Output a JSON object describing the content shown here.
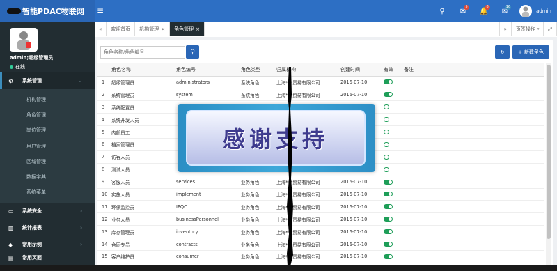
{
  "brand": {
    "title": "智能PDAC物联网"
  },
  "topbar": {
    "badges": [
      "5",
      "8",
      "16"
    ],
    "username": "admin",
    "badge_colors": [
      "#dd4b39",
      "#dd4b39",
      "#3c8dbc"
    ]
  },
  "profile": {
    "name": "admin;超级管理员",
    "status": "在线"
  },
  "menu": {
    "system": "系统管理",
    "sub": [
      "机构管理",
      "角色管理",
      "岗位管理",
      "用户管理",
      "区域管理",
      "数据字典",
      "系统菜单"
    ],
    "security": "系统安全",
    "reports": "统计报表",
    "examples": "常用示例",
    "tools": "常用页面"
  },
  "tabs": {
    "home": "欢迎首页",
    "org": "机构管理",
    "role": "角色管理",
    "ops": "页签操作"
  },
  "search": {
    "placeholder": "角色名称/角色编号"
  },
  "buttons": {
    "new": "新建角色"
  },
  "table": {
    "headers": [
      "角色名称",
      "角色编号",
      "角色类型",
      "归属机构",
      "创建时间",
      "有效",
      "备注"
    ],
    "rows": [
      {
        "n": "1",
        "name": "超级管理员",
        "code": "administrators",
        "type": "系统角色",
        "org": "上海***贸易有限公司",
        "date": "2016-07-10",
        "on": true
      },
      {
        "n": "2",
        "name": "系统管理员",
        "code": "system",
        "type": "系统角色",
        "org": "上海***贸易有限公司",
        "date": "2016-07-10",
        "on": true
      },
      {
        "n": "3",
        "name": "系统配置员",
        "code": "",
        "type": "",
        "org": "",
        "date": "",
        "on": false
      },
      {
        "n": "4",
        "name": "系统开发人员",
        "code": "",
        "type": "",
        "org": "",
        "date": "",
        "on": false
      },
      {
        "n": "5",
        "name": "内部员工",
        "code": "",
        "type": "",
        "org": "",
        "date": "",
        "on": false
      },
      {
        "n": "6",
        "name": "档案管理员",
        "code": "",
        "type": "",
        "org": "",
        "date": "",
        "on": false
      },
      {
        "n": "7",
        "name": "访客人员",
        "code": "",
        "type": "",
        "org": "",
        "date": "",
        "on": false
      },
      {
        "n": "8",
        "name": "测试人员",
        "code": "",
        "type": "",
        "org": "",
        "date": "",
        "on": false
      },
      {
        "n": "9",
        "name": "客服人员",
        "code": "services",
        "type": "业务角色",
        "org": "上海***贸易有限公司",
        "date": "2016-07-10",
        "on": true
      },
      {
        "n": "10",
        "name": "实施人员",
        "code": "implement",
        "type": "业务角色",
        "org": "上海***贸易有限公司",
        "date": "2016-07-10",
        "on": true
      },
      {
        "n": "11",
        "name": "环保监控员",
        "code": "IPQC",
        "type": "业务角色",
        "org": "上海***贸易有限公司",
        "date": "2016-07-10",
        "on": true
      },
      {
        "n": "12",
        "name": "业务人员",
        "code": "businessPersonnel",
        "type": "业务角色",
        "org": "上海***贸易有限公司",
        "date": "2016-07-10",
        "on": true
      },
      {
        "n": "13",
        "name": "库存管理员",
        "code": "inventory",
        "type": "业务角色",
        "org": "上海***贸易有限公司",
        "date": "2016-07-10",
        "on": true
      },
      {
        "n": "14",
        "name": "合同专员",
        "code": "contracts",
        "type": "业务角色",
        "org": "上海***贸易有限公司",
        "date": "2016-07-10",
        "on": true
      },
      {
        "n": "15",
        "name": "客户维护员",
        "code": "consumer",
        "type": "业务角色",
        "org": "上海***贸易有限公司",
        "date": "2016-07-10",
        "on": true
      }
    ]
  },
  "overlay": {
    "text": "感谢支持"
  }
}
